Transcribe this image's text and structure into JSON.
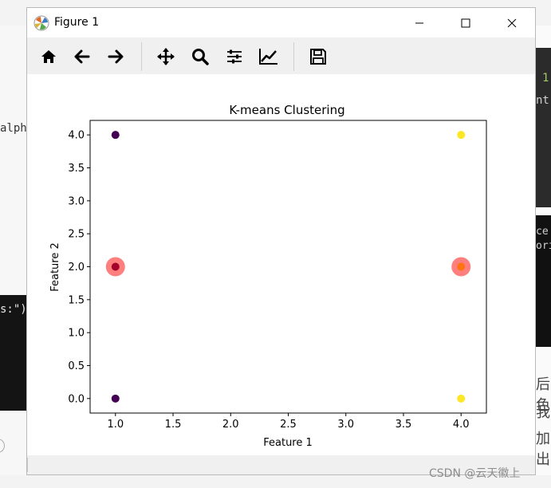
{
  "background": {
    "left_text_1": "alph",
    "left_text_2": "s:\")",
    "right_num": "1",
    "right_nt": "nt",
    "right_txt_1": "ce",
    "right_txt_2": "ori",
    "right_cjk_1": "后色",
    "right_cjk_2": "我",
    "right_cjk_3": "加出",
    "watermark": "CSDN @云天徽上"
  },
  "window": {
    "title": "Figure 1",
    "controls": [
      "minimize",
      "maximize",
      "close"
    ]
  },
  "toolbar": {
    "buttons": [
      {
        "icon": "home-icon",
        "tooltip": "Home"
      },
      {
        "icon": "back-arrow-icon",
        "tooltip": "Back"
      },
      {
        "icon": "forward-arrow-icon",
        "tooltip": "Forward"
      },
      {
        "icon": "pan-move-icon",
        "tooltip": "Pan"
      },
      {
        "icon": "zoom-magnifier-icon",
        "tooltip": "Zoom"
      },
      {
        "icon": "subplots-sliders-icon",
        "tooltip": "Subplots"
      },
      {
        "icon": "edit-axis-icon",
        "tooltip": "Customize"
      },
      {
        "icon": "save-floppy-icon",
        "tooltip": "Save"
      }
    ]
  },
  "colors": {
    "cluster_0": "#440154",
    "cluster_1": "#fde725",
    "centroid": "#ff0000"
  },
  "chart_data": {
    "type": "scatter",
    "title": "K-means Clustering",
    "xlabel": "Feature 1",
    "ylabel": "Feature 2",
    "xlim": [
      0.78,
      4.22
    ],
    "ylim": [
      -0.22,
      4.22
    ],
    "xticks": [
      "1.0",
      "1.5",
      "2.0",
      "2.5",
      "3.0",
      "3.5",
      "4.0"
    ],
    "yticks": [
      "0.0",
      "0.5",
      "1.0",
      "1.5",
      "2.0",
      "2.5",
      "3.0",
      "3.5",
      "4.0"
    ],
    "grid": false,
    "points": [
      {
        "x": 1,
        "y": 2,
        "cluster": 0
      },
      {
        "x": 1,
        "y": 4,
        "cluster": 0
      },
      {
        "x": 1,
        "y": 0,
        "cluster": 0
      },
      {
        "x": 4,
        "y": 2,
        "cluster": 1
      },
      {
        "x": 4,
        "y": 4,
        "cluster": 1
      },
      {
        "x": 4,
        "y": 0,
        "cluster": 1
      }
    ],
    "centroids": [
      {
        "x": 1,
        "y": 2
      },
      {
        "x": 4,
        "y": 2
      }
    ]
  }
}
